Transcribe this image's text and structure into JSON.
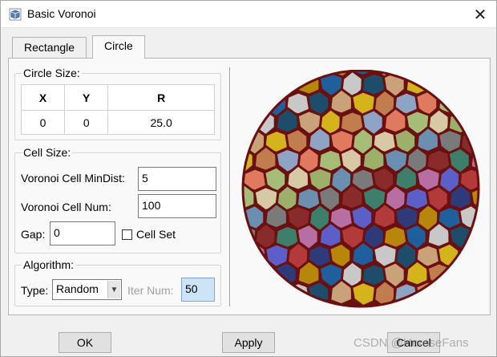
{
  "window": {
    "title": "Basic Voronoi",
    "close_glyph": "✕"
  },
  "tabs": [
    {
      "label": "Rectangle",
      "active": false
    },
    {
      "label": "Circle",
      "active": true
    }
  ],
  "circle_size": {
    "legend": "Circle Size:",
    "headers": [
      "X",
      "Y",
      "R"
    ],
    "values": [
      "0",
      "0",
      "25.0"
    ]
  },
  "cell_size": {
    "legend": "Cell Size:",
    "min_dist_label": "Voronoi Cell MinDist:",
    "min_dist_value": "5",
    "num_label": "Voronoi Cell Num:",
    "num_value": "100",
    "gap_label": "Gap:",
    "gap_value": "0",
    "cell_set_label": "Cell Set",
    "cell_set_checked": false
  },
  "algorithm": {
    "legend": "Algorithm:",
    "type_label": "Type:",
    "type_value": "Random",
    "iter_label": "Iter Num:",
    "iter_value": "50"
  },
  "buttons": {
    "ok": "OK",
    "apply": "Apply",
    "cancel": "Cancel"
  },
  "watermark": "CSDN @HeroseFans",
  "colors": {
    "cell_border": "#6b1010",
    "palette": [
      "#3c7f6b",
      "#b33a3a",
      "#1f5f9c",
      "#c9a27a",
      "#8fa3c4",
      "#d8c9a6",
      "#7a7a7a",
      "#b76fa3",
      "#2e3a7a",
      "#c8c8c8",
      "#d4b41a",
      "#e07a5f",
      "#9cb06a",
      "#8a2b2b",
      "#5b5fc7",
      "#b8860b",
      "#1e4d6b",
      "#c27d4f",
      "#a6bd78",
      "#6a8fb0"
    ]
  }
}
